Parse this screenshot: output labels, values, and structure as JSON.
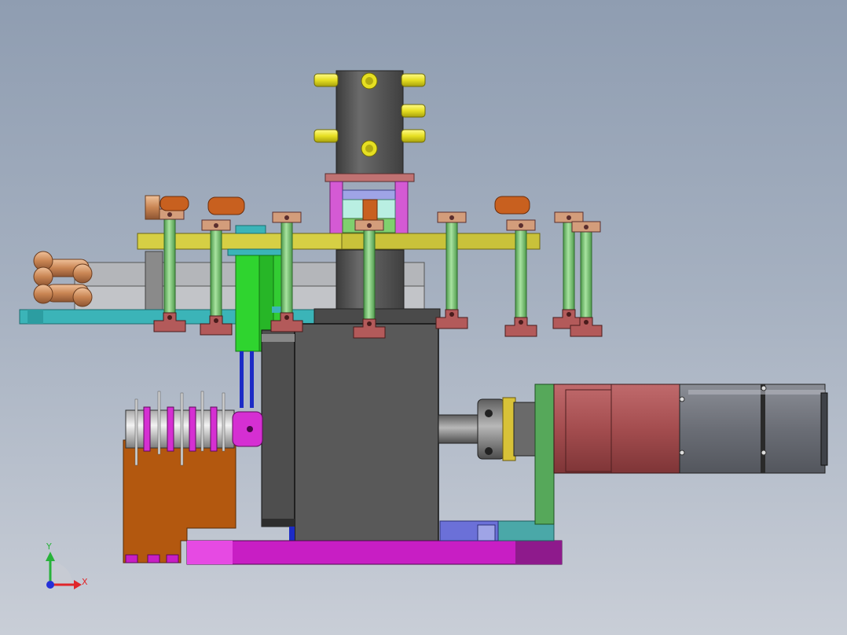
{
  "view": {
    "background_top": "#8f9db1",
    "background_bottom": "#c9ced7"
  },
  "triad": {
    "x_label": "X",
    "y_label": "Y",
    "x_color": "#e0262a",
    "y_color": "#27b23a",
    "z_color": "#2430d8"
  },
  "colors": {
    "motor_red": "#a44d4f",
    "motor_gray": "#6b6e76",
    "base_magenta": "#c81ec4",
    "cylinder_gray": "#565656",
    "plate_yellow": "#c9c23a",
    "rod_green": "#7ec47a",
    "bracket_red": "#b35a5a",
    "rail_teal": "#3bb4b8",
    "spindle_magenta": "#d52fd2",
    "block_brown": "#b3580f",
    "fitting_copper": "#c98553",
    "mount_green": "#56a85a",
    "lavender": "#9fa4e6",
    "fitting_yellow": "#e6df22"
  }
}
